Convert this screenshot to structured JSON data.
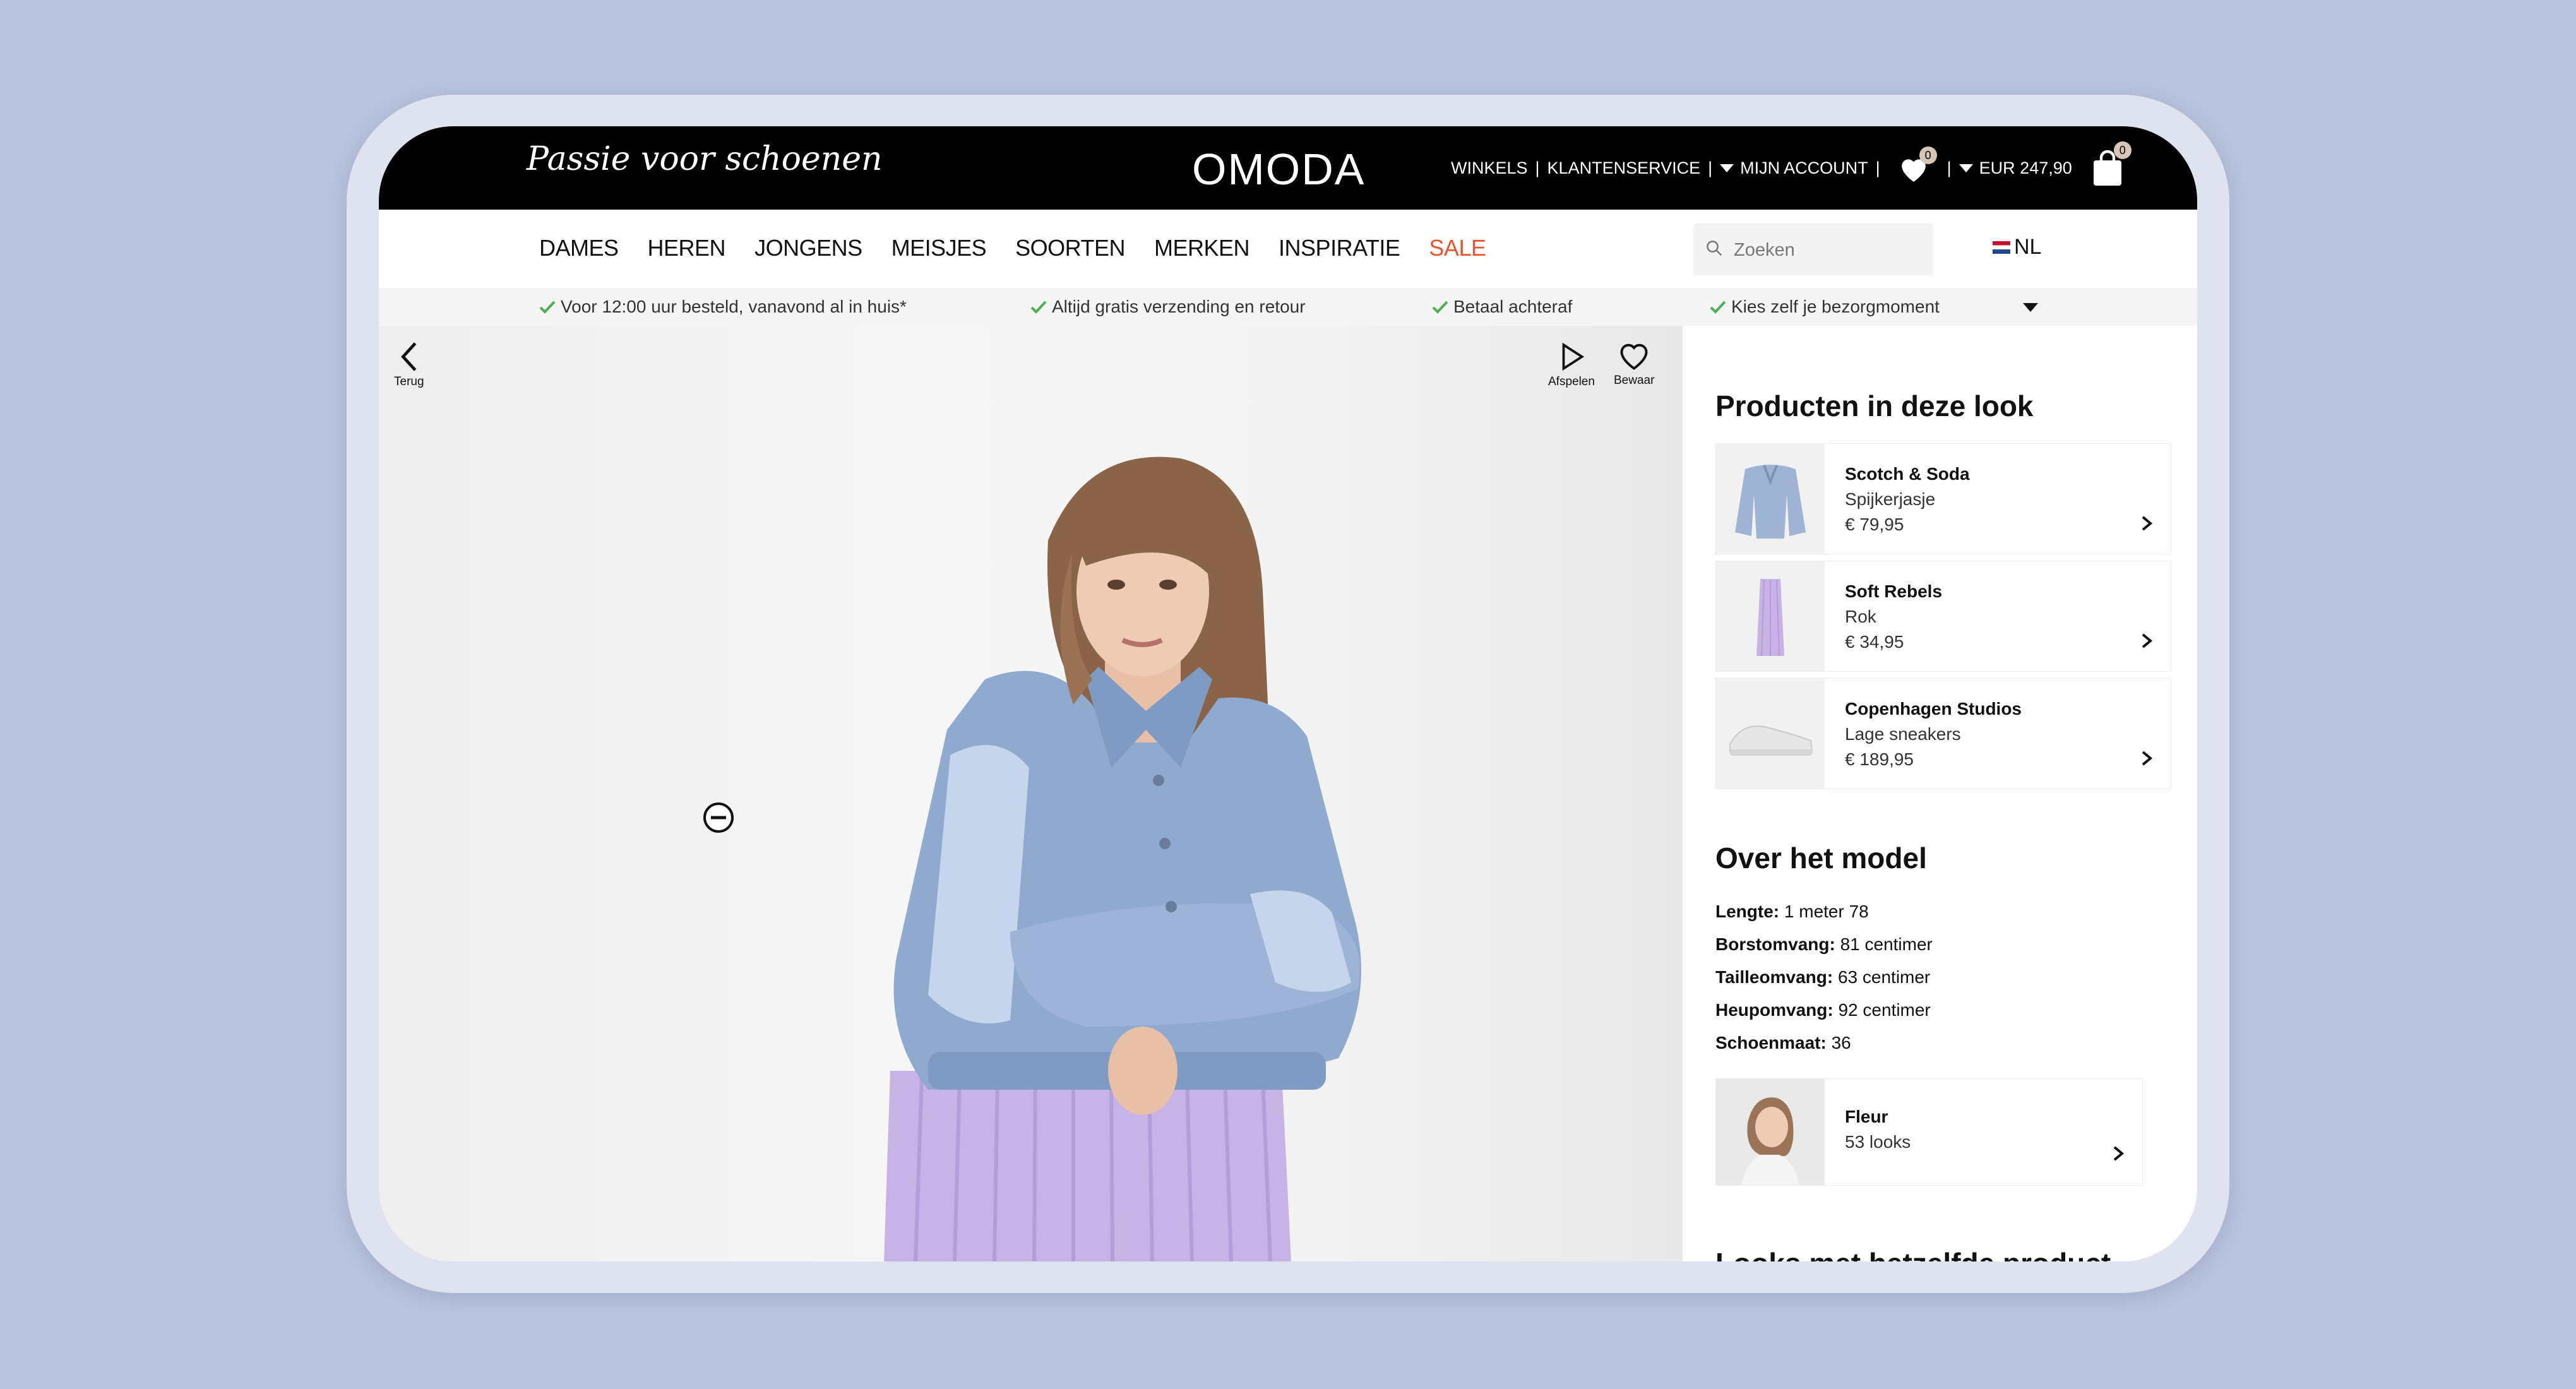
{
  "header": {
    "slogan": "Passie voor schoenen",
    "logo": "OMODA",
    "links": {
      "stores": "WINKELS",
      "customer_service": "KLANTENSERVICE",
      "my_account": "MIJN ACCOUNT",
      "cart_total": "EUR 247,90"
    },
    "wishlist_count": "0",
    "cart_count": "0"
  },
  "nav": {
    "items": [
      "DAMES",
      "HEREN",
      "JONGENS",
      "MEISJES",
      "SOORTEN",
      "MERKEN",
      "INSPIRATIE"
    ],
    "sale": "SALE",
    "search_placeholder": "Zoeken",
    "language": "NL",
    "sale_color": "#e8542c"
  },
  "usps": [
    "Voor 12:00 uur besteld, vanavond al in huis*",
    "Altijd gratis verzending en retour",
    "Betaal achteraf",
    "Kies zelf je bezorgmoment"
  ],
  "photo_controls": {
    "back": "Terug",
    "play": "Afspelen",
    "save": "Bewaar"
  },
  "products_section": {
    "title": "Producten in deze look",
    "items": [
      {
        "brand": "Scotch & Soda",
        "type": "Spijkerjasje",
        "price": "€ 79,95"
      },
      {
        "brand": "Soft Rebels",
        "type": "Rok",
        "price": "€ 34,95"
      },
      {
        "brand": "Copenhagen Studios",
        "type": "Lage sneakers",
        "price": "€ 189,95"
      }
    ]
  },
  "model_section": {
    "title": "Over het model",
    "specs": [
      {
        "label": "Lengte:",
        "value": "1 meter 78"
      },
      {
        "label": "Borstomvang:",
        "value": "81 centimer"
      },
      {
        "label": "Tailleomvang:",
        "value": "63 centimer"
      },
      {
        "label": "Heupomvang:",
        "value": "92 centimer"
      },
      {
        "label": "Schoenmaat:",
        "value": "36"
      }
    ],
    "model_name": "Fleur",
    "model_looks": "53 looks"
  },
  "next_section_title": "Looks met hetzelfde product",
  "colors": {
    "background": "#b9c3dd",
    "check": "#4caf50",
    "accent": "#e8542c"
  }
}
